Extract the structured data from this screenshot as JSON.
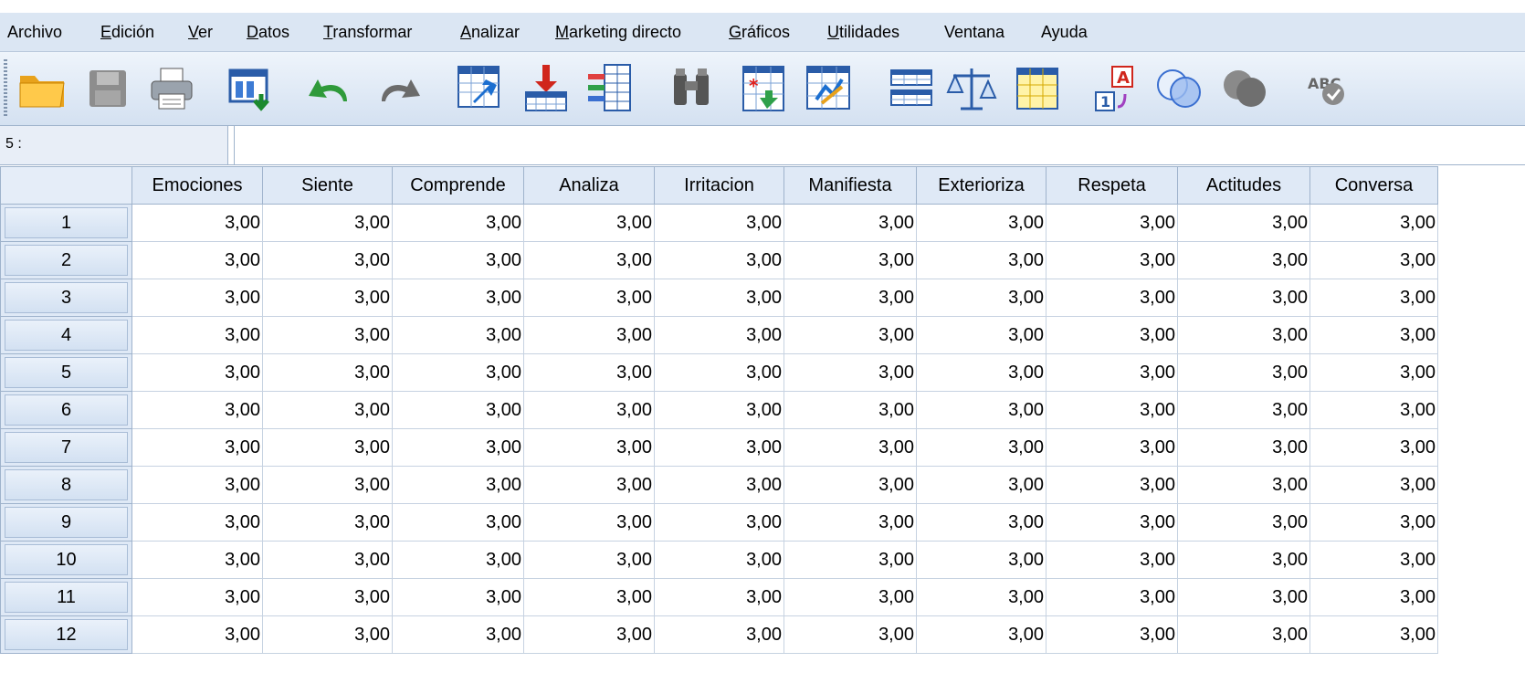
{
  "menu": {
    "items": [
      "Archivo",
      "Edición",
      "Ver",
      "Datos",
      "Transformar",
      "Analizar",
      "Marketing directo",
      "Gráficos",
      "Utilidades",
      "Ventana",
      "Ayuda"
    ]
  },
  "toolbar": {
    "icons": [
      "open-folder-icon",
      "save-disk-icon",
      "print-icon",
      "dialog-recall-icon",
      "undo-icon",
      "redo-icon",
      "goto-case-icon",
      "goto-variable-icon",
      "variables-icon",
      "find-binoculars-icon",
      "insert-cases-icon",
      "insert-variable-icon",
      "split-file-icon",
      "weight-cases-icon",
      "select-cases-icon",
      "value-labels-icon",
      "use-variable-sets-icon",
      "show-all-variables-icon",
      "spell-check-icon"
    ]
  },
  "cell_editor": {
    "reference": "5 :",
    "value": ""
  },
  "grid": {
    "columns": [
      "Emociones",
      "Siente",
      "Comprende",
      "Analiza",
      "Irritacion",
      "Manifiesta",
      "Exterioriza",
      "Respeta",
      "Actitudes",
      "Conversa"
    ],
    "rows": [
      {
        "id": "1",
        "values": [
          "3,00",
          "3,00",
          "3,00",
          "3,00",
          "3,00",
          "3,00",
          "3,00",
          "3,00",
          "3,00",
          "3,00"
        ]
      },
      {
        "id": "2",
        "values": [
          "3,00",
          "3,00",
          "3,00",
          "3,00",
          "3,00",
          "3,00",
          "3,00",
          "3,00",
          "3,00",
          "3,00"
        ]
      },
      {
        "id": "3",
        "values": [
          "3,00",
          "3,00",
          "3,00",
          "3,00",
          "3,00",
          "3,00",
          "3,00",
          "3,00",
          "3,00",
          "3,00"
        ]
      },
      {
        "id": "4",
        "values": [
          "3,00",
          "3,00",
          "3,00",
          "3,00",
          "3,00",
          "3,00",
          "3,00",
          "3,00",
          "3,00",
          "3,00"
        ]
      },
      {
        "id": "5",
        "values": [
          "3,00",
          "3,00",
          "3,00",
          "3,00",
          "3,00",
          "3,00",
          "3,00",
          "3,00",
          "3,00",
          "3,00"
        ]
      },
      {
        "id": "6",
        "values": [
          "3,00",
          "3,00",
          "3,00",
          "3,00",
          "3,00",
          "3,00",
          "3,00",
          "3,00",
          "3,00",
          "3,00"
        ]
      },
      {
        "id": "7",
        "values": [
          "3,00",
          "3,00",
          "3,00",
          "3,00",
          "3,00",
          "3,00",
          "3,00",
          "3,00",
          "3,00",
          "3,00"
        ]
      },
      {
        "id": "8",
        "values": [
          "3,00",
          "3,00",
          "3,00",
          "3,00",
          "3,00",
          "3,00",
          "3,00",
          "3,00",
          "3,00",
          "3,00"
        ]
      },
      {
        "id": "9",
        "values": [
          "3,00",
          "3,00",
          "3,00",
          "3,00",
          "3,00",
          "3,00",
          "3,00",
          "3,00",
          "3,00",
          "3,00"
        ]
      },
      {
        "id": "10",
        "values": [
          "3,00",
          "3,00",
          "3,00",
          "3,00",
          "3,00",
          "3,00",
          "3,00",
          "3,00",
          "3,00",
          "3,00"
        ]
      },
      {
        "id": "11",
        "values": [
          "3,00",
          "3,00",
          "3,00",
          "3,00",
          "3,00",
          "3,00",
          "3,00",
          "3,00",
          "3,00",
          "3,00"
        ]
      },
      {
        "id": "12",
        "values": [
          "3,00",
          "3,00",
          "3,00",
          "3,00",
          "3,00",
          "3,00",
          "3,00",
          "3,00",
          "3,00",
          "3,00"
        ]
      }
    ]
  },
  "colors": {
    "menubar": "#dbe6f3",
    "header": "#dfe9f6",
    "gridline": "#c6d2e1"
  }
}
